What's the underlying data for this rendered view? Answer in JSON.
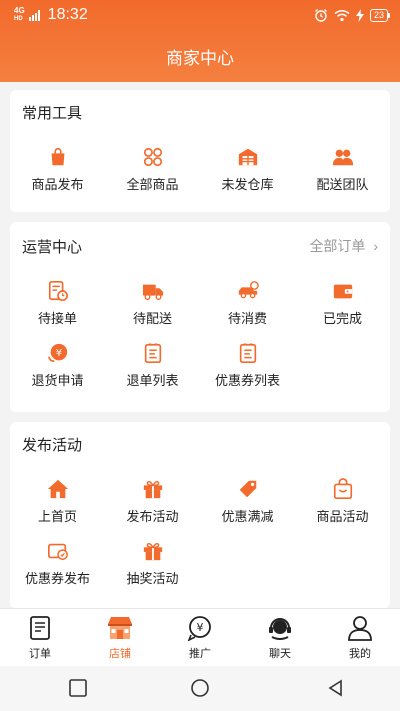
{
  "status": {
    "network": "4G",
    "network_sub": "HD",
    "time": "18:32",
    "battery": "23"
  },
  "header": {
    "title": "商家中心"
  },
  "tools": {
    "title": "常用工具",
    "items": [
      {
        "label": "商品发布",
        "icon": "shopping-bag-icon"
      },
      {
        "label": "全部商品",
        "icon": "grid-icon"
      },
      {
        "label": "未发仓库",
        "icon": "warehouse-icon"
      },
      {
        "label": "配送团队",
        "icon": "team-icon"
      }
    ]
  },
  "operations": {
    "title": "运营中心",
    "link": "全部订单",
    "items": [
      {
        "label": "待接单",
        "icon": "order-clock-icon"
      },
      {
        "label": "待配送",
        "icon": "truck-icon"
      },
      {
        "label": "待消费",
        "icon": "car-icon"
      },
      {
        "label": "已完成",
        "icon": "wallet-icon"
      },
      {
        "label": "退货申请",
        "icon": "yen-return-icon"
      },
      {
        "label": "退单列表",
        "icon": "list-icon"
      },
      {
        "label": "优惠券列表",
        "icon": "coupon-list-icon"
      }
    ]
  },
  "activities": {
    "title": "发布活动",
    "items": [
      {
        "label": "上首页",
        "icon": "home-icon"
      },
      {
        "label": "发布活动",
        "icon": "gift-icon"
      },
      {
        "label": "优惠满减",
        "icon": "tag-icon"
      },
      {
        "label": "商品活动",
        "icon": "shopping-bag-icon"
      },
      {
        "label": "优惠券发布",
        "icon": "coupon-icon"
      },
      {
        "label": "抽奖活动",
        "icon": "gift-icon"
      }
    ]
  },
  "tabbar": {
    "items": [
      {
        "label": "订单",
        "icon": "order-icon"
      },
      {
        "label": "店铺",
        "icon": "store-icon"
      },
      {
        "label": "推广",
        "icon": "promotion-icon"
      },
      {
        "label": "聊天",
        "icon": "headset-icon"
      },
      {
        "label": "我的",
        "icon": "user-icon"
      }
    ],
    "active": "店铺"
  },
  "colors": {
    "accent": "#f26a2c",
    "text": "#222222",
    "muted": "#9a9a9a"
  }
}
